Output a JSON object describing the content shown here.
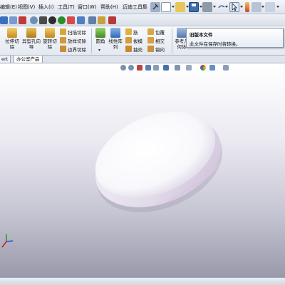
{
  "menu": {
    "items": [
      "编辑(E)",
      "视图(V)",
      "插入(I)",
      "工具(T)",
      "窗口(W)",
      "帮助(H)",
      "迈迪工具集"
    ]
  },
  "features": {
    "extrude_cut": "拉伸切除",
    "hole_wizard": "异型孔向导",
    "revolve_cut": "旋转切除",
    "swept_cut": "扫描切除",
    "loft_cut": "放样切除",
    "boundary_cut": "边界切除",
    "fillet": "圆角",
    "linear_pattern": "线性阵列",
    "rib": "筋",
    "draft": "拔模",
    "shell": "抽壳",
    "wrap": "包覆",
    "intersect": "相交",
    "mirror": "镜向",
    "ref_geometry": "参考几何体"
  },
  "tooltip": {
    "title": "旧版本文件",
    "text": "此文件在保存时将转换。"
  },
  "tabs": {
    "insert_tab": "ert",
    "office_tab": "办公室产品"
  },
  "colors": {
    "accent": "#2b6cc4",
    "model": "#f4f2f8",
    "background_bottom": "#9999ab"
  }
}
